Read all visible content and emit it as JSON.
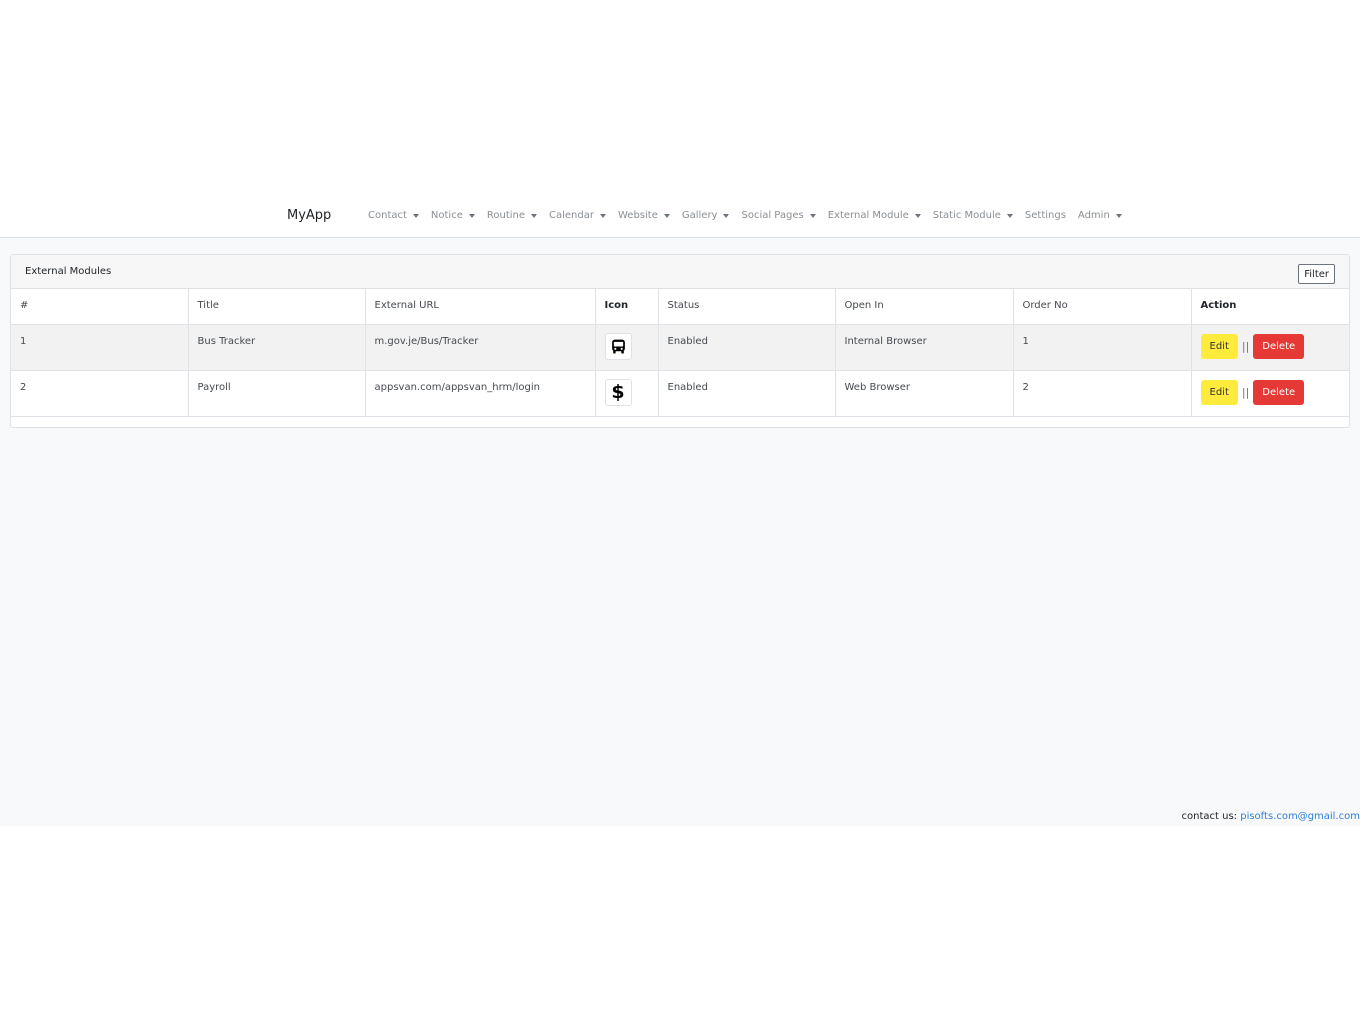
{
  "brand": "MyApp",
  "nav": [
    {
      "label": "Contact",
      "dropdown": true
    },
    {
      "label": "Notice",
      "dropdown": true
    },
    {
      "label": "Routine",
      "dropdown": true
    },
    {
      "label": "Calendar",
      "dropdown": true
    },
    {
      "label": "Website",
      "dropdown": true
    },
    {
      "label": "Gallery",
      "dropdown": true
    },
    {
      "label": "Social Pages",
      "dropdown": true
    },
    {
      "label": "External Module",
      "dropdown": true
    },
    {
      "label": "Static Module",
      "dropdown": true
    },
    {
      "label": "Settings",
      "dropdown": false
    },
    {
      "label": "Admin",
      "dropdown": true
    }
  ],
  "card": {
    "title": "External Modules",
    "filter_label": "Filter"
  },
  "table": {
    "headers": [
      "#",
      "Title",
      "External URL",
      "Icon",
      "Status",
      "Open In",
      "Order No",
      "Action"
    ],
    "rows": [
      {
        "num": "1",
        "title": "Bus Tracker",
        "url": "m.gov.je/Bus/Tracker",
        "icon": "bus-icon",
        "status": "Enabled",
        "open_in": "Internal Browser",
        "order": "1"
      },
      {
        "num": "2",
        "title": "Payroll",
        "url": "appsvan.com/appsvan_hrm/login",
        "icon": "dollar-icon",
        "status": "Enabled",
        "open_in": "Web Browser",
        "order": "2"
      }
    ],
    "edit_label": "Edit",
    "separator": "||",
    "delete_label": "Delete"
  },
  "footer": {
    "text": "contact us:",
    "email": "pisofts.com@gmail.com"
  },
  "colors": {
    "edit": "#ffeb3b",
    "delete": "#e53935",
    "link": "#2f7fd8"
  }
}
